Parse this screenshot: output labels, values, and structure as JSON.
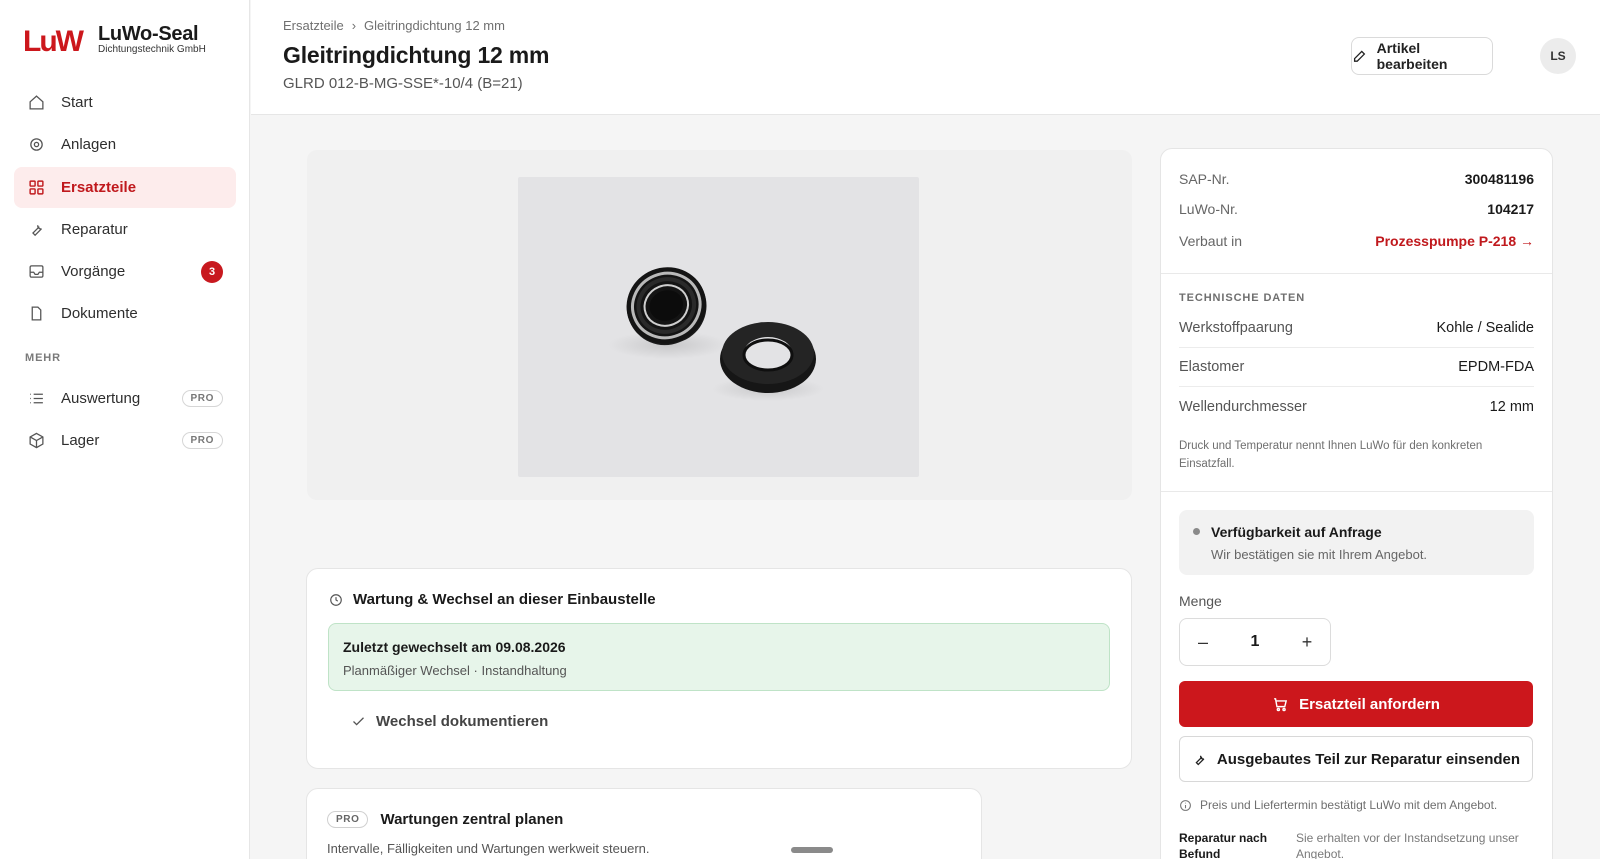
{
  "brand": {
    "name": "LuWo-Seal",
    "subtitle": "Dichtungstechnik GmbH",
    "logo_text": "LuW"
  },
  "sidebar": {
    "items": [
      {
        "label": "Start",
        "icon": "home-icon"
      },
      {
        "label": "Anlagen",
        "icon": "target-icon"
      },
      {
        "label": "Ersatzteile",
        "icon": "grid-icon",
        "active": true
      },
      {
        "label": "Reparatur",
        "icon": "wrench-icon"
      },
      {
        "label": "Vorgänge",
        "icon": "inbox-icon",
        "badge": "3"
      },
      {
        "label": "Dokumente",
        "icon": "file-icon"
      }
    ],
    "section_label": "MEHR",
    "more_items": [
      {
        "label": "Auswertung",
        "icon": "list-icon",
        "pill": "PRO"
      },
      {
        "label": "Lager",
        "icon": "box-icon",
        "pill": "PRO"
      }
    ]
  },
  "header": {
    "breadcrumb": [
      "Ersatzteile",
      "Gleitringdichtung 12 mm"
    ],
    "breadcrumb_sep": "›",
    "title": "Gleitringdichtung 12 mm",
    "subtitle": "GLRD 012-B-MG-SSE*-10/4 (B=21)",
    "edit_button": "Artikel bearbeiten",
    "avatar": "LS"
  },
  "maintenance": {
    "title": "Wartung & Wechsel an dieser Einbaustelle",
    "last_changed": "Zuletzt gewechselt am 09.08.2026",
    "last_changed_detail": "Planmäßiger Wechsel · Instandhaltung",
    "document_button": "Wechsel dokumentieren"
  },
  "pro_card": {
    "tag": "PRO",
    "title": "Wartungen zentral planen",
    "subtitle": "Intervalle, Fälligkeiten und Wartungen werkweit steuern."
  },
  "details": {
    "sap_label": "SAP-Nr.",
    "sap_value": "300481196",
    "luwo_label": "LuWo-Nr.",
    "luwo_value": "104217",
    "installed_label": "Verbaut in",
    "installed_value": "Prozesspumpe P-218 →",
    "tech_title": "TECHNISCHE DATEN",
    "tech": [
      {
        "k": "Werkstoffpaarung",
        "v": "Kohle / Sealide"
      },
      {
        "k": "Elastomer",
        "v": "EPDM-FDA"
      },
      {
        "k": "Wellendurchmesser",
        "v": "12 mm"
      }
    ],
    "note": "Druck und Temperatur nennt Ihnen LuWo für den konkreten Einsatzfall.",
    "availability_title": "Verfügbarkeit auf Anfrage",
    "availability_sub": "Wir bestätigen sie mit Ihrem Angebot.",
    "qty_label": "Menge",
    "qty_value": "1",
    "qty_minus": "–",
    "qty_plus": "+",
    "order_button": "Ersatzteil anfordern",
    "repair_button": "Ausgebautes Teil zur Reparatur einsenden",
    "info_text": "Preis und Liefertermin bestätigt LuWo mit dem Angebot.",
    "repair_label": "Reparatur nach Befund",
    "repair_text": "Sie erhalten vor der Instandsetzung unser Angebot."
  },
  "colors": {
    "accent": "#cc171c",
    "success_bg": "#e7f5ea"
  }
}
